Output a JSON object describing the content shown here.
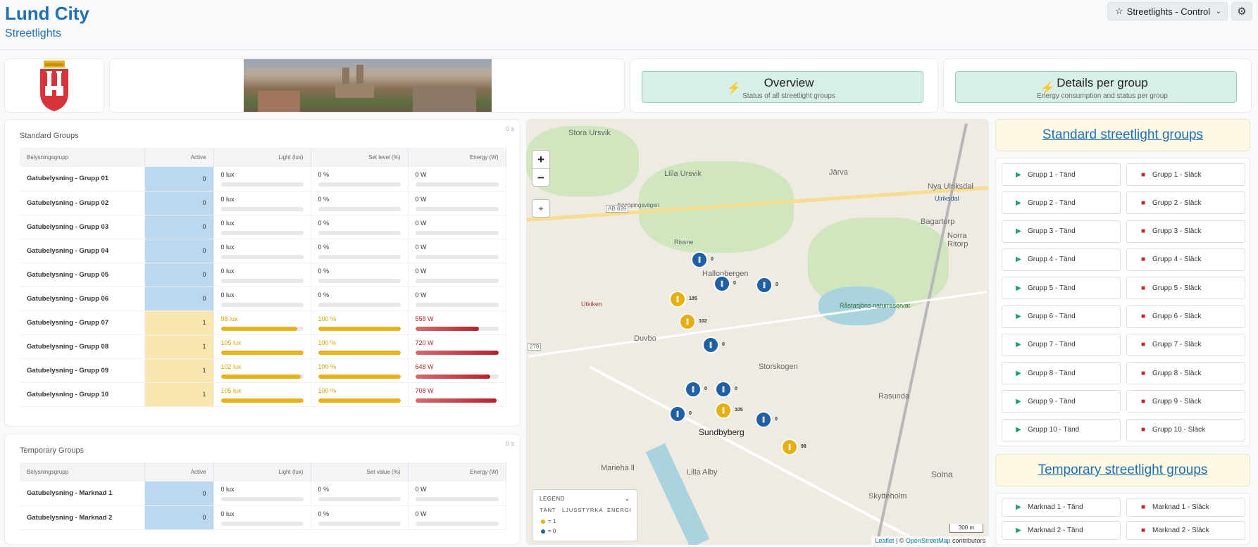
{
  "header": {
    "title": "Lund City",
    "subtitle": "Streetlights",
    "dashboard": "Streetlights - Control"
  },
  "nav": [
    {
      "title": "Overview",
      "subtitle": "Status of all streetlight groups"
    },
    {
      "title": "Details per group",
      "subtitle": "Energy consumption and status per group"
    }
  ],
  "standard": {
    "title": "Standard Groups",
    "timer": "0 s",
    "columns": [
      "Belysningsgrupp",
      "Active",
      "Light (lux)",
      "Set level (%)",
      "Energy (W)"
    ],
    "rows": [
      {
        "name": "Gatubelysning - Grupp 01",
        "active": "0",
        "light": "0 lux",
        "light_pct": 0,
        "level": "0 %",
        "level_pct": 0,
        "energy": "0 W",
        "energy_pct": 0
      },
      {
        "name": "Gatubelysning - Grupp 02",
        "active": "0",
        "light": "0 lux",
        "light_pct": 0,
        "level": "0 %",
        "level_pct": 0,
        "energy": "0 W",
        "energy_pct": 0
      },
      {
        "name": "Gatubelysning - Grupp 03",
        "active": "0",
        "light": "0 lux",
        "light_pct": 0,
        "level": "0 %",
        "level_pct": 0,
        "energy": "0 W",
        "energy_pct": 0
      },
      {
        "name": "Gatubelysning - Grupp 04",
        "active": "0",
        "light": "0 lux",
        "light_pct": 0,
        "level": "0 %",
        "level_pct": 0,
        "energy": "0 W",
        "energy_pct": 0
      },
      {
        "name": "Gatubelysning - Grupp 05",
        "active": "0",
        "light": "0 lux",
        "light_pct": 0,
        "level": "0 %",
        "level_pct": 0,
        "energy": "0 W",
        "energy_pct": 0
      },
      {
        "name": "Gatubelysning - Grupp 06",
        "active": "0",
        "light": "0 lux",
        "light_pct": 0,
        "level": "0 %",
        "level_pct": 0,
        "energy": "0 W",
        "energy_pct": 0
      },
      {
        "name": "Gatubelysning - Grupp 07",
        "active": "1",
        "light": "98 lux",
        "light_pct": 93,
        "level": "100 %",
        "level_pct": 100,
        "energy": "558 W",
        "energy_pct": 77
      },
      {
        "name": "Gatubelysning - Grupp 08",
        "active": "1",
        "light": "105 lux",
        "light_pct": 100,
        "level": "100 %",
        "level_pct": 100,
        "energy": "720 W",
        "energy_pct": 100
      },
      {
        "name": "Gatubelysning - Grupp 09",
        "active": "1",
        "light": "102 lux",
        "light_pct": 97,
        "level": "100 %",
        "level_pct": 100,
        "energy": "648 W",
        "energy_pct": 90
      },
      {
        "name": "Gatubelysning - Grupp 10",
        "active": "1",
        "light": "105 lux",
        "light_pct": 100,
        "level": "100 %",
        "level_pct": 100,
        "energy": "708 W",
        "energy_pct": 98
      }
    ]
  },
  "temporary": {
    "title": "Temporary Groups",
    "timer": "0 s",
    "columns": [
      "Belysningsgrupp",
      "Active",
      "Light (lux)",
      "Set value (%)",
      "Energy (W)"
    ],
    "rows": [
      {
        "name": "Gatubelysning - Marknad 1",
        "active": "0",
        "light": "0 lux",
        "light_pct": 0,
        "level": "0 %",
        "level_pct": 0,
        "energy": "0 W",
        "energy_pct": 0
      },
      {
        "name": "Gatubelysning - Marknad 2",
        "active": "0",
        "light": "0 lux",
        "light_pct": 0,
        "level": "0 %",
        "level_pct": 0,
        "energy": "0 W",
        "energy_pct": 0
      }
    ]
  },
  "map": {
    "labels": [
      "Stora Ursvik",
      "Lilla Ursvik",
      "Järva",
      "Nya Ulriksdal",
      "Ulriksdal",
      "Bagartorp",
      "Norra Ritorp",
      "Hallonbergen",
      "Rissne",
      "Duvbo",
      "Utkiken",
      "Storskogen",
      "Sundbyberg",
      "Rasunda",
      "Solna",
      "Marieha ll",
      "Lilla Alby",
      "Skytteholm",
      "Råstasjöns naturreservat",
      "Enköpingsvägen",
      "AB 839",
      "279"
    ],
    "markers": [
      {
        "color": "b",
        "label": "0"
      },
      {
        "color": "b",
        "label": "0"
      },
      {
        "color": "b",
        "label": "0"
      },
      {
        "color": "y",
        "label": "105"
      },
      {
        "color": "y",
        "label": "102"
      },
      {
        "color": "b",
        "label": "0"
      },
      {
        "color": "b",
        "label": "0"
      },
      {
        "color": "b",
        "label": "0"
      },
      {
        "color": "y",
        "label": "105"
      },
      {
        "color": "b",
        "label": "0"
      },
      {
        "color": "b",
        "label": "0"
      },
      {
        "color": "y",
        "label": "98"
      }
    ],
    "zoom_in": "+",
    "zoom_out": "−",
    "legend": {
      "title": "LEGEND",
      "cols": [
        "TÄNT",
        "LJUSSTYRKA",
        "ENERGI"
      ],
      "on": "= 1",
      "off": "= 0"
    },
    "scale": "300 m",
    "attribution": {
      "leaflet": "Leaflet",
      "sep": " | © ",
      "osm": "OpenStreetMap",
      "tail": " contributors"
    },
    "colors": {
      "on": "#e6b012",
      "off": "#1f5fa3"
    }
  },
  "controls": {
    "standard_title": "Standard streetlight groups",
    "standard": [
      [
        "Grupp 1 - Tänd",
        "Grupp 1 - Släck"
      ],
      [
        "Grupp 2 - Tänd",
        "Grupp 2 - Släck"
      ],
      [
        "Grupp 3 - Tänd",
        "Grupp 3 - Släck"
      ],
      [
        "Grupp 4 - Tänd",
        "Grupp 4 - Släck"
      ],
      [
        "Grupp 5 - Tänd",
        "Grupp 5 - Släck"
      ],
      [
        "Grupp 6 - Tänd",
        "Grupp 6 - Släck"
      ],
      [
        "Grupp 7 - Tänd",
        "Grupp 7 - Släck"
      ],
      [
        "Grupp 8 - Tänd",
        "Grupp 8 - Släck"
      ],
      [
        "Grupp 9 - Tänd",
        "Grupp 9 - Släck"
      ],
      [
        "Grupp 10 - Tänd",
        "Grupp 10 - Släck"
      ]
    ],
    "temporary_title": "Temporary streetlight groups",
    "temporary": [
      [
        "Marknad 1 - Tänd",
        "Marknad 1 - Släck"
      ],
      [
        "Marknad 2 - Tänd",
        "Marknad 2 - Släck"
      ]
    ]
  }
}
